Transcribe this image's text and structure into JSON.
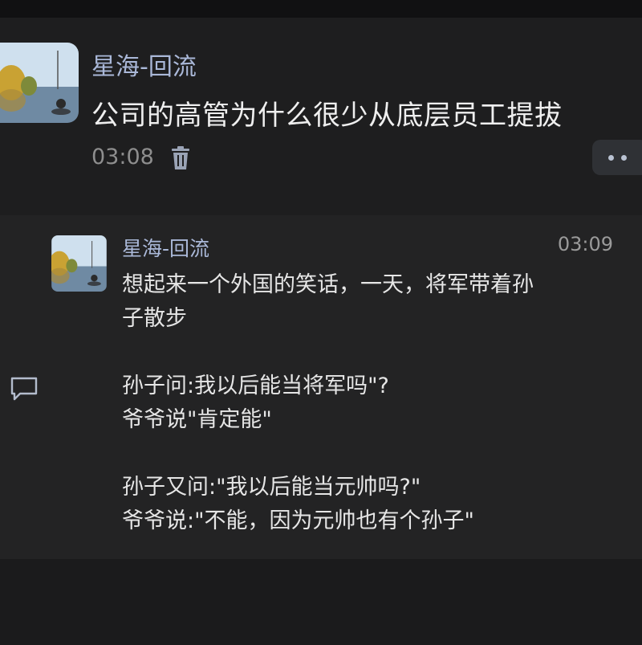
{
  "post": {
    "author": "星海-回流",
    "title": "公司的高管为什么很少从底层员工提拔",
    "time": "03:08",
    "avatar_icon": "lake-landscape-avatar",
    "delete_icon": "trash-icon",
    "more_icon": "more-dots-icon"
  },
  "comment": {
    "author": "星海-回流",
    "time": "03:09",
    "avatar_icon": "lake-landscape-avatar",
    "reply_icon": "comment-bubble-icon",
    "lines": [
      "想起来一个外国的笑话，一天，将军带着孙",
      "子散步",
      "",
      "孙子问:我以后能当将军吗\"?",
      "爷爷说\"肯定能\"",
      "",
      "孙子又问:\"我以后能当元帅吗?\"",
      "爷爷说:\"不能，因为元帅也有个孙子\""
    ]
  },
  "colors": {
    "background": "#1b1b1c",
    "author": "#aab8d8",
    "text": "#e6e6e6",
    "muted": "#8e8e8e"
  }
}
